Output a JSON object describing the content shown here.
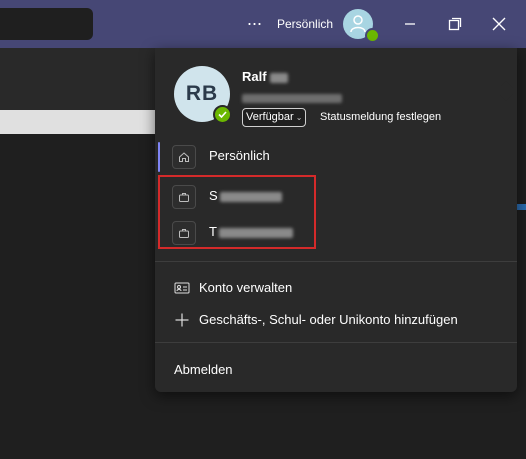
{
  "titlebar": {
    "more_label": "···",
    "account_label": "Persönlich",
    "status_color": "#6bb700"
  },
  "profile": {
    "initials": "RB",
    "first_name": "Ralf",
    "status": "Verfügbar",
    "status_message": "Statusmeldung festlegen"
  },
  "accounts": [
    {
      "label": "Persönlich",
      "icon": "home-icon",
      "active": true
    },
    {
      "label": "S",
      "icon": "briefcase-icon",
      "active": false
    },
    {
      "label": "T",
      "icon": "briefcase-icon",
      "active": false
    }
  ],
  "actions": {
    "manage_account": "Konto verwalten",
    "add_account": "Geschäfts-, Schul- oder Unikonto hinzufügen",
    "logout": "Abmelden"
  },
  "colors": {
    "titlebar": "#464775",
    "menu_bg": "#292929",
    "active_indicator": "#7f85f5",
    "highlight": "#d42a2a"
  }
}
